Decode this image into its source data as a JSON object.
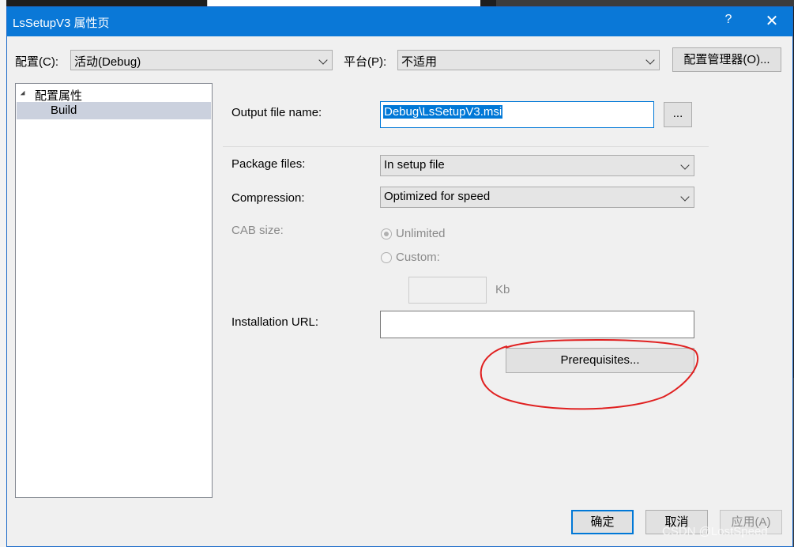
{
  "window": {
    "title": "LsSetupV3 属性页",
    "help_label": "?",
    "close_label": "✕"
  },
  "config_bar": {
    "config_label": "配置(C):",
    "config_value": "活动(Debug)",
    "platform_label": "平台(P):",
    "platform_value": "不适用",
    "manager_button": "配置管理器(O)..."
  },
  "tree": {
    "root_label": "配置属性",
    "items": [
      {
        "label": "Build"
      }
    ]
  },
  "form": {
    "output_file_label": "Output file name:",
    "output_file_value": "Debug\\LsSetupV3.msi",
    "browse_button": "...",
    "package_files_label": "Package files:",
    "package_files_value": "In setup file",
    "compression_label": "Compression:",
    "compression_value": "Optimized for speed",
    "cab_size_label": "CAB size:",
    "cab_unlimited_label": "Unlimited",
    "cab_custom_label": "Custom:",
    "cab_custom_value": "",
    "cab_unit": "Kb",
    "installation_url_label": "Installation URL:",
    "installation_url_value": "",
    "prerequisites_button": "Prerequisites..."
  },
  "footer": {
    "ok_button": "确定",
    "cancel_button": "取消",
    "apply_button": "应用(A)"
  },
  "annotation": {
    "color": "#e02020",
    "target": "prerequisites-button"
  },
  "watermark": "CSDN @LostSpeed",
  "colors": {
    "titlebar": "#0a78d7",
    "selection": "#0078d7",
    "tree_selected": "#cbd1de"
  }
}
